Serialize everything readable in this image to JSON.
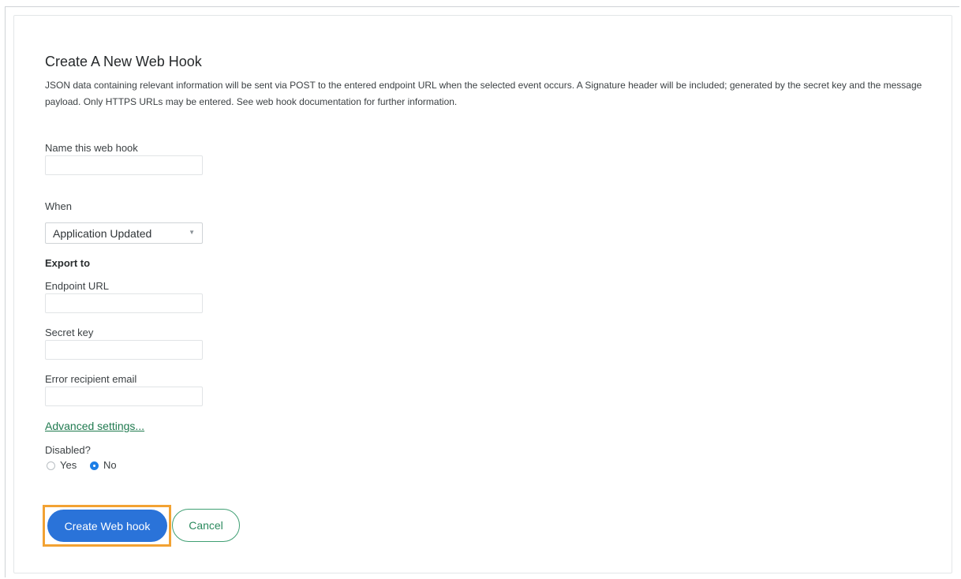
{
  "page": {
    "title": "Create A New Web Hook",
    "description": "JSON data containing relevant information will be sent via POST to the entered endpoint URL when the selected event occurs. A Signature header will be included; generated by the secret key and the message payload. Only HTTPS URLs may be entered. See web hook documentation for further information."
  },
  "form": {
    "name_label": "Name this web hook",
    "name_value": "",
    "when_label": "When",
    "when_selected": "Application Updated",
    "export_heading": "Export to",
    "endpoint_label": "Endpoint URL",
    "endpoint_value": "",
    "secret_label": "Secret key",
    "secret_value": "",
    "error_email_label": "Error recipient email",
    "error_email_value": "",
    "advanced_link": "Advanced settings...",
    "disabled_label": "Disabled?",
    "disabled_options": [
      {
        "label": "Yes",
        "selected": false
      },
      {
        "label": "No",
        "selected": true
      }
    ]
  },
  "actions": {
    "create_label": "Create Web hook",
    "cancel_label": "Cancel"
  },
  "icons": {
    "select_caret": "caret-down-icon"
  },
  "colors": {
    "primary": "#2a73d9",
    "link": "#1f7a4f",
    "highlight": "#f2a233",
    "radio_selected": "#1c7ee6"
  }
}
